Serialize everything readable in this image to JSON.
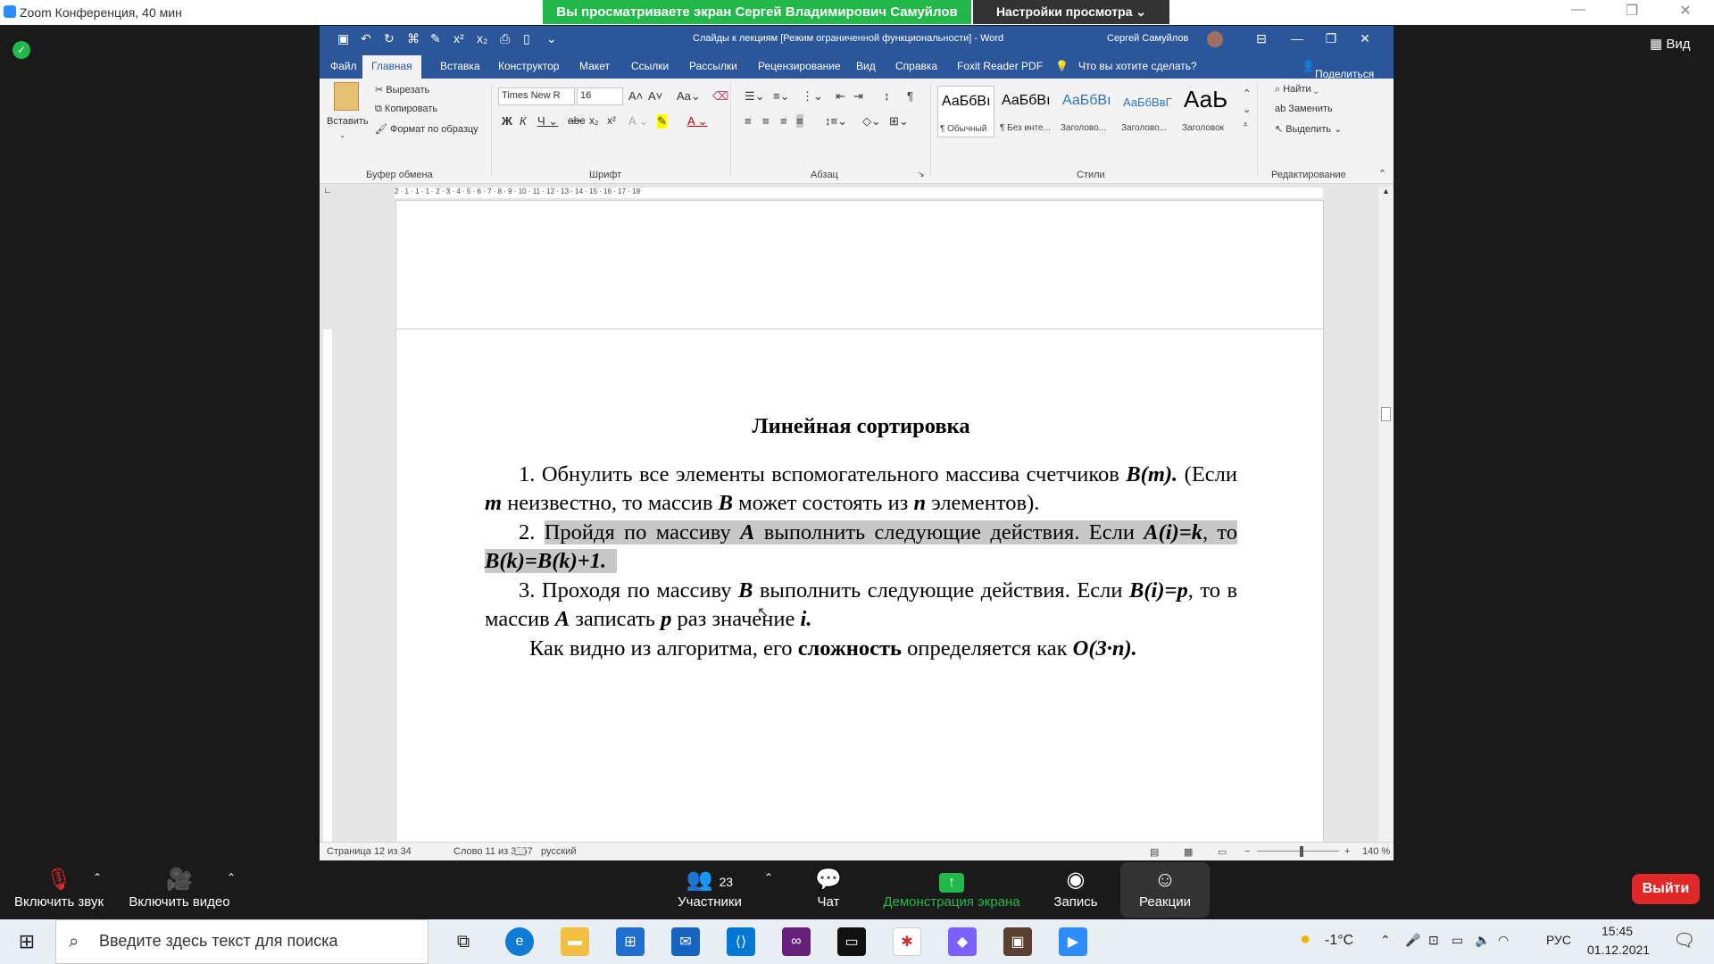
{
  "zoom": {
    "window_title": "Zoom Конференция, 40 мин",
    "banner_viewing": "Вы просматриваете экран Сергей Владимирович Самуйлов",
    "banner_options": "Настройки просмотра ⌄",
    "view_label": "Вид",
    "bottom": {
      "audio": "Включить звук",
      "video": "Включить видео",
      "participants": "Участники",
      "participants_count": "23",
      "chat": "Чат",
      "share": "Демонстрация экрана",
      "record": "Запись",
      "reactions": "Реакции",
      "exit": "Выйти"
    }
  },
  "word": {
    "title": "Слайды к лекциям [Режим ограниченной функциональности]  -  Word",
    "user": "Сергей Самуйлов",
    "tabs": [
      "Файл",
      "Главная",
      "Вставка",
      "Конструктор",
      "Макет",
      "Ссылки",
      "Рассылки",
      "Рецензирование",
      "Вид",
      "Справка",
      "Foxit Reader PDF"
    ],
    "tell_me": "Что вы хотите сделать?",
    "share": "Поделиться",
    "clipboard": {
      "paste": "Вставить",
      "cut": "Вырезать",
      "copy": "Копировать",
      "format": "Формат по образцу",
      "group": "Буфер обмена"
    },
    "font": {
      "name": "Times New R",
      "size": "16",
      "group": "Шрифт"
    },
    "paragraph_group": "Абзац",
    "styles": [
      {
        "preview": "АаБбВı",
        "name": "¶ Обычный"
      },
      {
        "preview": "АаБбВı",
        "name": "¶ Без инте..."
      },
      {
        "preview": "АаБбВı",
        "name": "Заголово..."
      },
      {
        "preview": "АаБбВвГ",
        "name": "Заголово..."
      },
      {
        "preview": "АаЬ",
        "name": "Заголовок"
      }
    ],
    "styles_group": "Стили",
    "editing": {
      "find": "Найти",
      "replace": "Заменить",
      "select": "Выделить",
      "group": "Редактирование"
    },
    "ruler_text": "2 · 1 · 1 · 1 · 2 · 3 · 4 · 5 · 6 · 7 · 8 · 9 · 10 · 11 · 12 · 13 · 14 · 15 · 16 · 17 · 18",
    "status": {
      "page": "Страница 12 из 34",
      "words": "Слово 11 из 3557",
      "lang": "русский",
      "zoom": "140 %"
    },
    "doc": {
      "title": "Линейная сортировка",
      "item1_num": "1.",
      "item1_a": "Обнулить все элементы вспомогательного массива счетчиков",
      "item1_b": "B(m).",
      "item1_c": "(Если",
      "item1_d": "m",
      "item1_e": "неизвестно, то массив",
      "item1_f": "B",
      "item1_g": "может состоять из",
      "item1_h": "n",
      "item1_i": "элементов).",
      "item2_num": "2.",
      "item2_a": "Пройдя по массиву",
      "item2_b": "A",
      "item2_c": "выполнить следующие действия. Если",
      "item2_d": "A(i)=k",
      "item2_e": ", то",
      "item2_f": "B(k)=B(k)+1.",
      "item3_num": "3.",
      "item3_a": "Проходя по массиву",
      "item3_b": "B",
      "item3_c": "выполнить следующие действия. Если",
      "item3_d": "B(i)=p",
      "item3_e": ", то в массив",
      "item3_f": "A",
      "item3_g": "записать",
      "item3_h": "p",
      "item3_i": "раз значение",
      "item3_j": "i.",
      "conclusion_a": "Как видно из алгоритма, его",
      "conclusion_b": "сложность",
      "conclusion_c": "определяется как",
      "conclusion_d": "O(3·n)."
    }
  },
  "taskbar": {
    "search_placeholder": "Введите здесь текст для поиска",
    "weather": "-1°C",
    "lang": "РУС",
    "time": "15:45",
    "date": "01.12.2021"
  },
  "colors": {
    "word_blue": "#2b579a",
    "zoom_green": "#22b94a",
    "exit_red": "#e02828"
  }
}
